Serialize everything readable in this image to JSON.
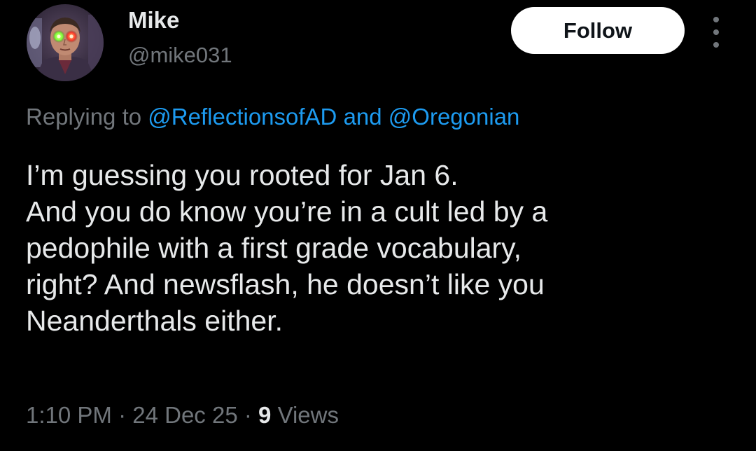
{
  "author": {
    "display_name": "Mike",
    "handle": "@mike031",
    "avatar_icon": "avatar-portrait-glowing-eyes"
  },
  "follow_button": {
    "label": "Follow"
  },
  "more_menu": {
    "icon": "vertical-ellipsis-icon"
  },
  "reply_context": {
    "prefix": "Replying to",
    "mentions": [
      "@ReflectionsofAD",
      "@Oregonian"
    ],
    "conjunction": "and"
  },
  "tweet": {
    "lines": [
      "I’m guessing you rooted for Jan 6.",
      "And you do know you’re in a cult led by a",
      "pedophile with a first grade vocabulary,",
      "right? And newsflash, he doesn’t like you",
      "Neanderthals either."
    ]
  },
  "meta": {
    "time": "1:10 PM",
    "date": "24 Dec 25",
    "separator": "·",
    "views_count": "9",
    "views_label": "Views"
  },
  "colors": {
    "background": "#000000",
    "primary_text": "#e7e9ea",
    "secondary_text": "#71767b",
    "link": "#1d9bf0",
    "button_bg": "#ffffff",
    "button_text": "#0f1419"
  }
}
